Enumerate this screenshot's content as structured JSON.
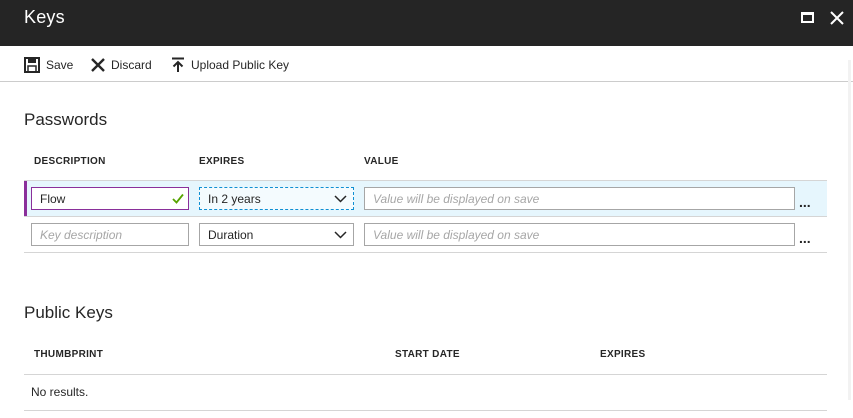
{
  "window": {
    "title": "Keys"
  },
  "toolbar": {
    "save_label": "Save",
    "discard_label": "Discard",
    "upload_label": "Upload Public Key"
  },
  "passwords": {
    "title": "Passwords",
    "columns": {
      "description": "DESCRIPTION",
      "expires": "EXPIRES",
      "value": "VALUE"
    },
    "rows": [
      {
        "description": "Flow",
        "expires": "In 2 years",
        "value_placeholder": "Value will be displayed on save",
        "more": "..."
      },
      {
        "description_placeholder": "Key description",
        "expires": "Duration",
        "value_placeholder": "Value will be displayed on save",
        "more": "..."
      }
    ]
  },
  "public_keys": {
    "title": "Public Keys",
    "columns": {
      "thumbprint": "THUMBPRINT",
      "start_date": "START DATE",
      "expires": "EXPIRES"
    },
    "empty_text": "No results."
  },
  "colors": {
    "titlebar_bg": "#252525",
    "selected_row_bg": "#e6f6fd",
    "row_accent": "#8a2f9a",
    "focus_border": "#0f8fd3",
    "valid_check": "#57a300"
  },
  "icons": {
    "save": "save-icon",
    "discard": "close-icon",
    "upload": "upload-icon",
    "maximize": "maximize-icon",
    "close": "close-icon",
    "check": "checkmark-icon",
    "dropdown": "chevron-down-icon"
  }
}
